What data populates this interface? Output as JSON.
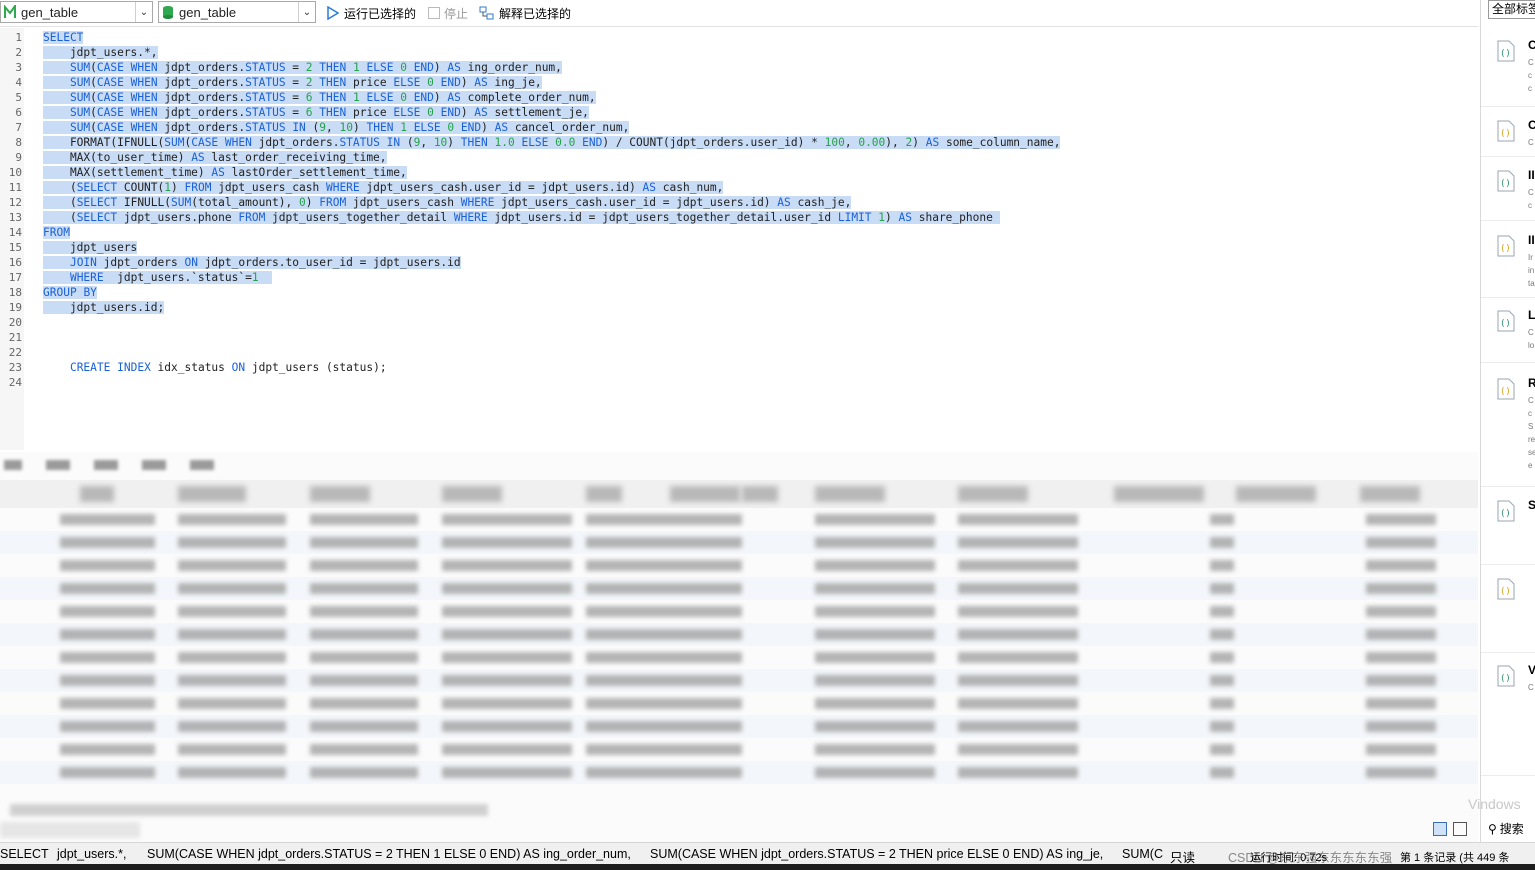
{
  "toolbar": {
    "db_combo": "gen_table",
    "schema_combo": "gen_table",
    "run_selected": "运行已选择的",
    "stop": "停止",
    "explain_selected": "解释已选择的"
  },
  "editor": {
    "lines": [
      {
        "n": "1",
        "code": "SELECT"
      },
      {
        "n": "2",
        "code": "    jdpt_users.*,"
      },
      {
        "n": "3",
        "code": "    SUM(CASE WHEN jdpt_orders.STATUS = 2 THEN 1 ELSE 0 END) AS ing_order_num,"
      },
      {
        "n": "4",
        "code": "    SUM(CASE WHEN jdpt_orders.STATUS = 2 THEN price ELSE 0 END) AS ing_je,"
      },
      {
        "n": "5",
        "code": "    SUM(CASE WHEN jdpt_orders.STATUS = 6 THEN 1 ELSE 0 END) AS complete_order_num,"
      },
      {
        "n": "6",
        "code": "    SUM(CASE WHEN jdpt_orders.STATUS = 6 THEN price ELSE 0 END) AS settlement_je,"
      },
      {
        "n": "7",
        "code": "    SUM(CASE WHEN jdpt_orders.STATUS IN (9, 10) THEN 1 ELSE 0 END) AS cancel_order_num,"
      },
      {
        "n": "8",
        "code": "    FORMAT(IFNULL(SUM(CASE WHEN jdpt_orders.STATUS IN (9, 10) THEN 1.0 ELSE 0.0 END) / COUNT(jdpt_orders.user_id) * 100, 0.00), 2) AS some_column_name,"
      },
      {
        "n": "9",
        "code": "    MAX(to_user_time) AS last_order_receiving_time,"
      },
      {
        "n": "10",
        "code": "    MAX(settlement_time) AS lastOrder_settlement_time,"
      },
      {
        "n": "11",
        "code": "    (SELECT COUNT(1) FROM jdpt_users_cash WHERE jdpt_users_cash.user_id = jdpt_users.id) AS cash_num,"
      },
      {
        "n": "12",
        "code": "    (SELECT IFNULL(SUM(total_amount), 0) FROM jdpt_users_cash WHERE jdpt_users_cash.user_id = jdpt_users.id) AS cash_je,"
      },
      {
        "n": "13",
        "code": "    (SELECT jdpt_users.phone FROM jdpt_users_together_detail WHERE jdpt_users.id = jdpt_users_together_detail.user_id LIMIT 1) AS share_phone "
      },
      {
        "n": "14",
        "code": "FROM"
      },
      {
        "n": "15",
        "code": "    jdpt_users"
      },
      {
        "n": "16",
        "code": "    JOIN jdpt_orders ON jdpt_orders.to_user_id = jdpt_users.id"
      },
      {
        "n": "17",
        "code": "    WHERE  jdpt_users.`status`=1  "
      },
      {
        "n": "18",
        "code": "GROUP BY"
      },
      {
        "n": "19",
        "code": "    jdpt_users.id;"
      },
      {
        "n": "20",
        "code": ""
      },
      {
        "n": "21",
        "code": ""
      },
      {
        "n": "22",
        "code": ""
      },
      {
        "n": "23",
        "code": "    CREATE INDEX idx_status ON jdpt_users (status);"
      },
      {
        "n": "24",
        "code": ""
      }
    ]
  },
  "right_panel": {
    "filter": "全部标签",
    "items": [
      {
        "letter": "C",
        "sub": [
          "C",
          "c",
          "c"
        ]
      },
      {
        "letter": "C",
        "sub": [
          "C"
        ]
      },
      {
        "letter": "II",
        "sub": [
          "C",
          "c"
        ]
      },
      {
        "letter": "II",
        "sub": [
          "Ir",
          "in",
          "ta"
        ]
      },
      {
        "letter": "L",
        "sub": [
          "C",
          "lo"
        ]
      },
      {
        "letter": "R",
        "sub": [
          "C",
          "c",
          "S",
          "re",
          "se",
          "e"
        ]
      },
      {
        "letter": "S",
        "sub": []
      },
      {
        "letter": "",
        "sub": []
      },
      {
        "letter": "V",
        "sub": [
          "C"
        ]
      }
    ],
    "search": "搜索",
    "windows_watermark": "Vindows"
  },
  "statusbar": {
    "items": [
      "SELECT",
      "jdpt_users.*,",
      "SUM(CASE WHEN jdpt_orders.STATUS = 2 THEN 1 ELSE 0 END) AS ing_order_num,",
      "SUM(CASE WHEN jdpt_orders.STATUS = 2 THEN price ELSE 0 END) AS ing_je,",
      "SUM(C",
      "只读",
      "CSDN @东东强东东东东东强",
      "运行时间: 0.72s",
      "第 1 条记录 (共 449 条"
    ]
  },
  "colors": {
    "selection": "#c9dcf6",
    "keyword": "#1a61d8",
    "number": "#25a24a",
    "run_icon": "#2d7bd4",
    "db_icon": "#2fa84f"
  }
}
